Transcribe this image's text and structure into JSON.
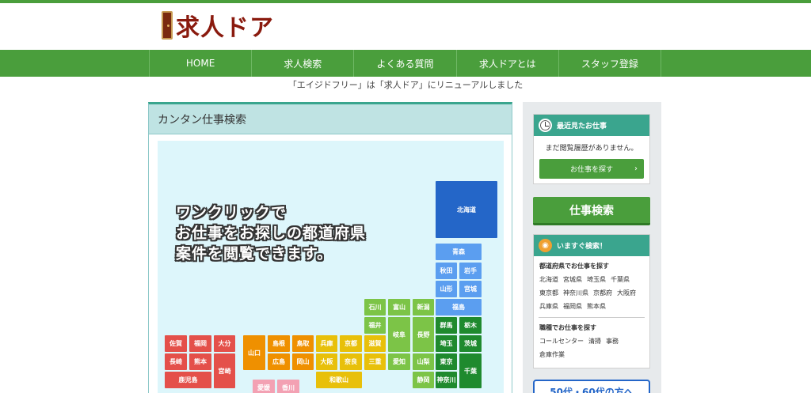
{
  "brand": {
    "logo_text": "求人ドア"
  },
  "nav": {
    "items": [
      {
        "label": "HOME"
      },
      {
        "label": "求人検索"
      },
      {
        "label": "よくある質問"
      },
      {
        "label": "求人ドアとは"
      },
      {
        "label": "スタッフ登録"
      }
    ]
  },
  "notice": "「エイジドフリー」は「求人ドア」にリニューアルしました",
  "main": {
    "title": "カンタン仕事検索",
    "headline": [
      "ワンクリックで",
      "お仕事をお探しの都道府県",
      "案件を閲覧できます。"
    ],
    "prefectures": {
      "hokkaido": "北海道",
      "aomori": "青森",
      "akita": "秋田",
      "iwate": "岩手",
      "yamagata": "山形",
      "miyagi": "宮城",
      "fukushima": "福島",
      "ishikawa": "石川",
      "toyama": "富山",
      "niigata": "新潟",
      "fukui": "福井",
      "gifu": "岐阜",
      "nagano": "長野",
      "gunma": "群馬",
      "tochigi": "栃木",
      "shiga": "滋賀",
      "saitama": "埼玉",
      "ibaraki": "茨城",
      "mie": "三重",
      "aichi": "愛知",
      "yamanashi": "山梨",
      "tokyo": "東京",
      "chiba": "千葉",
      "shizuoka": "静岡",
      "kanagawa": "神奈川",
      "hyogo": "兵庫",
      "kyoto": "京都",
      "osaka": "大阪",
      "nara": "奈良",
      "wakayama": "和歌山",
      "yamaguchi": "山口",
      "shimane": "島根",
      "tottori": "鳥取",
      "hiroshima": "広島",
      "okayama": "岡山",
      "ehime": "愛媛",
      "kagawa": "香川",
      "saga": "佐賀",
      "fukuoka": "福岡",
      "oita": "大分",
      "nagasaki": "長崎",
      "kumamoto": "熊本",
      "miyazaki": "宮崎",
      "kagoshima": "鹿児島"
    }
  },
  "sidebar": {
    "recent": {
      "title": "最近見たお仕事",
      "icon": "clock-icon",
      "empty": "まだ閲覧履歴がありません。",
      "button": "お仕事を探す",
      "arrow": "›"
    },
    "search_button": "仕事検索",
    "now": {
      "title": "いますぐ検索！",
      "icon": "wifi-icon",
      "pref_title": "都道府県でお仕事を探す",
      "pref_rows": [
        [
          "北海道",
          "宮城県",
          "埼玉県",
          "千葉県"
        ],
        [
          "東京都",
          "神奈川県",
          "京都府",
          "大阪府"
        ],
        [
          "兵庫県",
          "福岡県",
          "熊本県"
        ]
      ],
      "job_title": "職種でお仕事を探す",
      "job_rows": [
        [
          "コールセンター",
          "清掃",
          "事務"
        ],
        [
          "倉庫作業"
        ]
      ]
    },
    "banner": "50代・60代の方へ"
  },
  "colors": {
    "green": "#4a9e3c",
    "teal": "#3aa58e",
    "map_bg": "#ddf6fb",
    "hokkaido": "#2466c8",
    "tohoku": "#5b9ef0",
    "kanto": "#1f8a2e",
    "chubu": "#7cc447",
    "kinki": "#e8c00a",
    "chugoku": "#ef9000",
    "shikoku": "#f3a1b3",
    "kyushu": "#e4504a"
  }
}
